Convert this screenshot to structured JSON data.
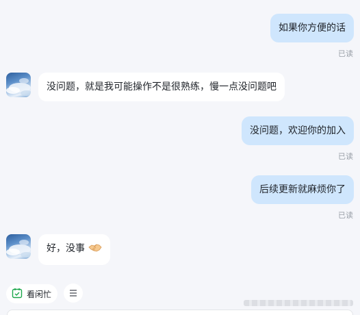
{
  "messages": [
    {
      "direction": "out",
      "text": "如果你方便的话",
      "status": "已读"
    },
    {
      "direction": "in",
      "text": "没问题，就是我可能操作不是很熟练，慢一点没问题吧"
    },
    {
      "direction": "out",
      "text": "没问题，欢迎你的加入",
      "status": "已读"
    },
    {
      "direction": "out",
      "text": "后续更新就麻烦你了",
      "status": "已读"
    },
    {
      "direction": "in",
      "text": "好，没事",
      "emoji": "handshake-emoji"
    }
  ],
  "toolbar": {
    "availability_label": "看闲忙",
    "availability_icon": "calendar-check-icon",
    "menu_icon": "menu-lines-icon"
  },
  "colors": {
    "background": "#f5f6fa",
    "outgoing_bubble": "#cfe6fd",
    "incoming_bubble": "#ffffff",
    "read_status": "#9aa0a8",
    "calendar_green": "#1aa64a"
  }
}
